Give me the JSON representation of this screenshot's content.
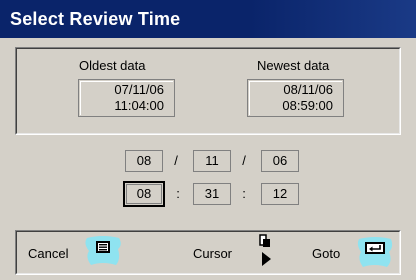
{
  "window": {
    "title": "Select Review Time"
  },
  "range": {
    "oldest": {
      "label": "Oldest data",
      "date": "07/11/06",
      "time": "11:04:00"
    },
    "newest": {
      "label": "Newest data",
      "date": "08/11/06",
      "time": "08:59:00"
    }
  },
  "selection": {
    "date": {
      "month": "08",
      "day": "11",
      "year": "06",
      "separator": "/"
    },
    "time": {
      "hour": "08",
      "minute": "31",
      "second": "12",
      "separator": ":"
    },
    "focused_field": "hour"
  },
  "actions": {
    "cancel": {
      "label": "Cancel",
      "icon": "list-icon"
    },
    "cursor": {
      "label": "Cursor",
      "icon": "cursor-toggle-icon"
    },
    "goto": {
      "label": "Goto",
      "icon": "goto-return-icon"
    }
  },
  "colors": {
    "titlebar": "#0a246a",
    "face": "#d4d0c8",
    "icon_accent": "#8fe3f0"
  }
}
